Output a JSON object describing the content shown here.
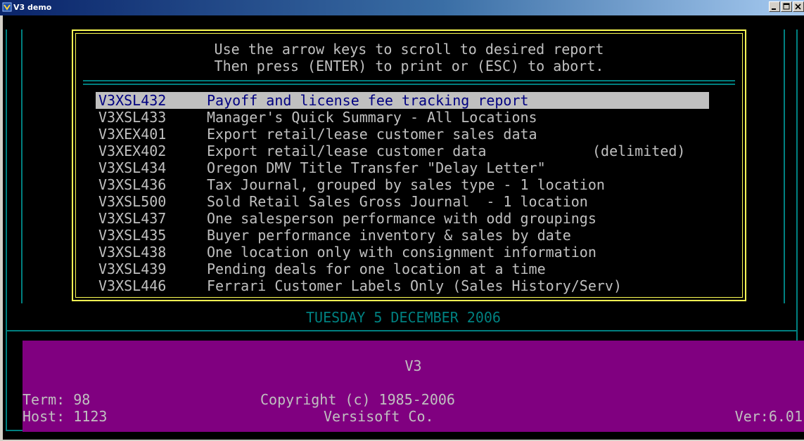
{
  "window": {
    "title": "V3 demo"
  },
  "instructions": {
    "line1": "Use the arrow keys to scroll to desired report",
    "line2": "Then press (ENTER) to print or (ESC) to abort."
  },
  "reports": [
    {
      "code": "V3XSL432",
      "desc": "Payoff and license fee tracking report",
      "extra": ""
    },
    {
      "code": "V3XSL433",
      "desc": "Manager's Quick Summary - All Locations",
      "extra": ""
    },
    {
      "code": "V3XEX401",
      "desc": "Export retail/lease customer sales data",
      "extra": ""
    },
    {
      "code": "V3XEX402",
      "desc": "Export retail/lease customer data",
      "extra": "(delimited)"
    },
    {
      "code": "V3XSL434",
      "desc": "Oregon DMV Title Transfer \"Delay Letter\"",
      "extra": ""
    },
    {
      "code": "V3XSL436",
      "desc": "Tax Journal, grouped by sales type - 1 location",
      "extra": ""
    },
    {
      "code": "V3XSL500",
      "desc": "Sold Retail Sales Gross Journal  - 1 location",
      "extra": ""
    },
    {
      "code": "V3XSL437",
      "desc": "One salesperson performance with odd groupings",
      "extra": ""
    },
    {
      "code": "V3XSL435",
      "desc": "Buyer performance inventory & sales by date",
      "extra": ""
    },
    {
      "code": "V3XSL438",
      "desc": "One location only with consignment information",
      "extra": ""
    },
    {
      "code": "V3XSL439",
      "desc": "Pending deals for one location at a time",
      "extra": ""
    },
    {
      "code": "V3XSL446",
      "desc": "Ferrari Customer Labels Only (Sales History/Serv)",
      "extra": ""
    }
  ],
  "date_line": "TUESDAY 5 DECEMBER 2006",
  "footer": {
    "app": "V3",
    "term": "Term: 98",
    "host": "Host: 1123",
    "copyright": "Copyright (c) 1985-2006",
    "company": "Versisoft Co.",
    "version": "Ver:6.01"
  },
  "colors": {
    "console_bg": "#000000",
    "frame": "#008080",
    "panel_border": "#ffff55",
    "text": "#c0c0c0",
    "highlight_bg": "#c0c0c0",
    "highlight_text": "#000080",
    "footer_bg": "#800080"
  }
}
